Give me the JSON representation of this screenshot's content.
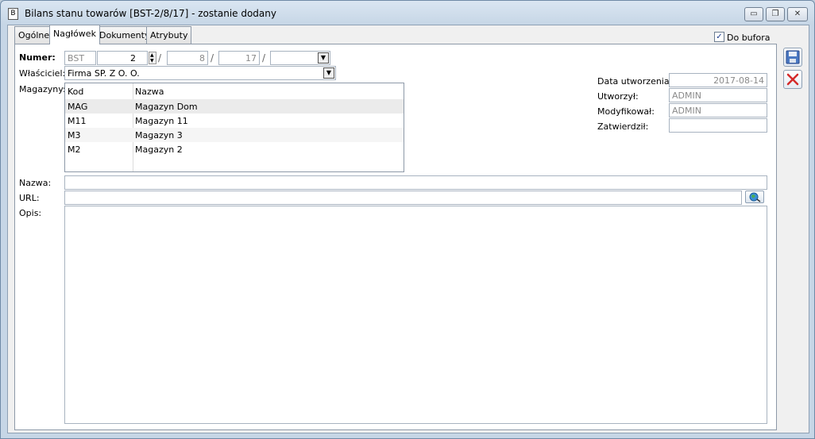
{
  "window": {
    "title": "Bilans stanu towarów [BST-2/8/17] - zostanie dodany",
    "minimize": "▭",
    "restore": "❐",
    "close": "✕"
  },
  "tabs": [
    "Ogólne",
    "Nagłówek",
    "Dokumenty",
    "Atrybuty"
  ],
  "active_tab": "Nagłówek",
  "do_bufora": {
    "label": "Do bufora",
    "checked": "✓"
  },
  "numer": {
    "label": "Numer:",
    "prefix": "BST",
    "number": "2",
    "sep1": "/",
    "month": "8",
    "sep2": "/",
    "year": "17",
    "sep3": "/",
    "series": ""
  },
  "wlasciciel": {
    "label": "Właściciel:",
    "value": "Firma SP. Z O. O."
  },
  "magazyny": {
    "label": "Magazyny:",
    "columns": [
      "Kod",
      "Nazwa"
    ],
    "rows": [
      {
        "kod": "MAG",
        "nazwa": "Magazyn Dom"
      },
      {
        "kod": "M11",
        "nazwa": "Magazyn 11"
      },
      {
        "kod": "M3",
        "nazwa": "Magazyn 3"
      },
      {
        "kod": "M2",
        "nazwa": "Magazyn 2"
      }
    ]
  },
  "info": {
    "data_utworzenia_label": "Data utworzenia:",
    "data_utworzenia": "2017-08-14",
    "utworzyl_label": "Utworzył:",
    "utworzyl": "ADMIN",
    "modyfikowal_label": "Modyfikował:",
    "modyfikowal": "ADMIN",
    "zatwierdzil_label": "Zatwierdził:",
    "zatwierdzil": ""
  },
  "nazwa": {
    "label": "Nazwa:",
    "value": ""
  },
  "url": {
    "label": "URL:",
    "value": ""
  },
  "opis": {
    "label": "Opis:",
    "value": ""
  },
  "colors": {
    "accent": "#1f5fbf",
    "close_red": "#d42a2a"
  }
}
